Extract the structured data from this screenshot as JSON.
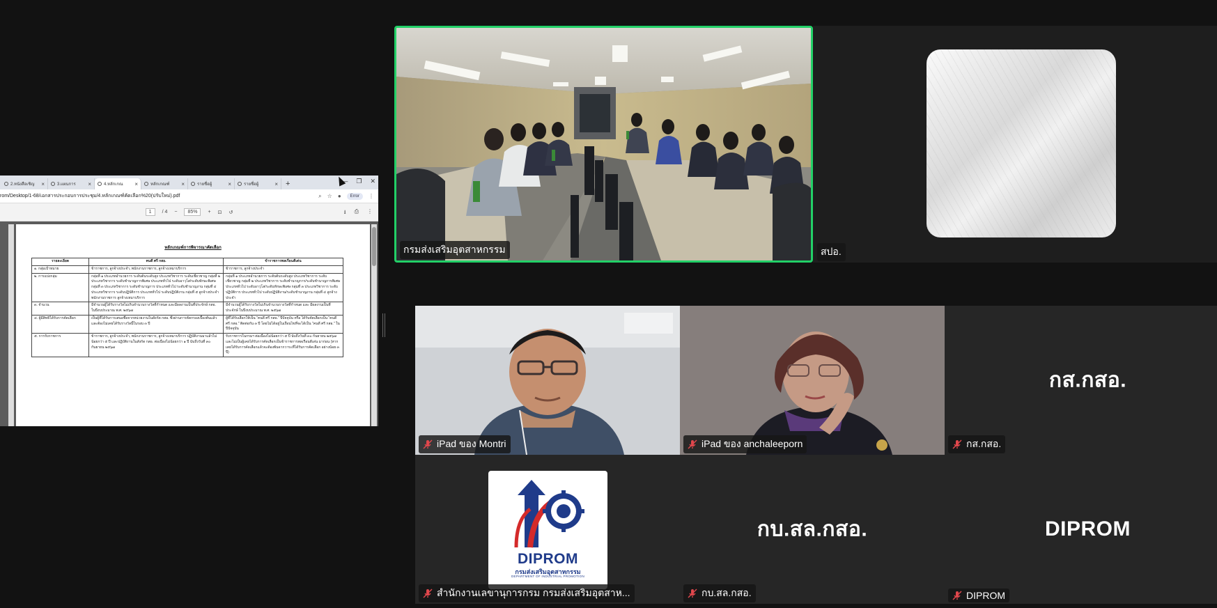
{
  "browser": {
    "tabs": [
      {
        "label": "2.หนังสือเชิญ"
      },
      {
        "label": "3.แผนการ"
      },
      {
        "label": "4.หลักเกณ"
      },
      {
        "label": "หลักเกณฑ์"
      },
      {
        "label": "รายชื่อผู้"
      },
      {
        "label": "รายชื่อผู้"
      }
    ],
    "new_tab": "+",
    "url": "rom/Desktop/1-68/เอกสารประกอบการประชุม/4.หลักเกณฑ์คัดเลือก%20(ปรับใหม่).pdf",
    "profile_label": "Error",
    "pdf": {
      "page_current": "1",
      "page_total": "/ 4",
      "zoom": "85%",
      "doc_title": "หลักเกณฑ์การพิจารณาคัดเลือก",
      "table": {
        "headers": [
          "รายละเอียด",
          "คนดี ศรี กสอ.",
          "ข้าราชการพลเรือนดีเด่น"
        ],
        "rows": [
          [
            "๑. กลุ่มเป้าหมาย",
            "ข้าราชการ, ลูกจ้างประจำ, พนักงานราชการ, ลูกจ้างเหมาบริการ",
            "ข้าราชการ, ลูกจ้างประจำ"
          ],
          [
            "๒. การแบ่งกลุ่ม",
            "กลุ่มที่ ๑ ประเภทอำนวยการ ระดับต้นระดับสูง ประเภทวิชาการ ระดับเชี่ยวชาญ กลุ่มที่ ๒ ประเภทวิชาการ ระดับชำนาญการพิเศษ ประเภททั่วไป ระดับอาวุโส/ระดับทักษะพิเศษ กลุ่มที่ ๓ ประเภทวิชาการ ระดับชำนาญการ ประเภททั่วไป ระดับชำนาญงาน กลุ่มที่ ๔ ประเภทวิชาการ ระดับปฏิบัติการ ประเภททั่วไป ระดับปฏิบัติงาน กลุ่มที่ ๕ ลูกจ้างประจำ พนักงานราชการ ลูกจ้างเหมาบริการ",
            "กลุ่มที่ ๑ ประเภทอำนวยการ ระดับต้นระดับสูง ประเภทวิชาการ ระดับเชี่ยวชาญ กลุ่มที่ ๒ ประเภทวิชาการ ระดับชำนาญการ/ระดับชำนาญการพิเศษ ประเภททั่วไป ระดับอาวุโส/ระดับทักษะพิเศษ กลุ่มที่ ๓ ประเภทวิชาการ ระดับปฏิบัติการ ประเภททั่วไป ระดับปฏิบัติงาน/ระดับชำนาญงาน กลุ่มที่ ๔ ลูกจ้างประจำ"
          ],
          [
            "๓. จำนวน",
            "มีจำนวนผู้ได้รับรางวัลไม่เกินจำนวนรางวัลที่กำหนด และมีผลงานเป็นที่ประจักษ์ กสอ. ในปีงบประมาณ พ.ศ. ๒๕๖๗",
            "มีจำนวนผู้ได้รับรางวัลไม่เกินจำนวนรางวัลที่กำหนด และ มีผลงานเป็นที่ประจักษ์ ในปีงบประมาณ พ.ศ. ๒๕๖๗"
          ],
          [
            "๔. ผู้มีสิทธิได้รับการคัดเลือก",
            "เป็นผู้ที่ได้รับการเสนอชื่อจากหน่วยงานในสังกัด กสอ. ซึ่งผ่านการคัดกรองเบื้องต้นแล้ว และต้องไม่เคยได้รับรางวัลนี้ในรอบ ๓ ปี",
            "ผู้ที่ได้รับเลือกให้เป็น \"คนดี ศรี กสอ.\" ปีปัจจุบัน หรือ ได้รับคัดเลือกเป็น \"คนดี ศรี กสอ.\" ติดต่อกัน ๓ ปี โดยไม่ได้อยู่ในเงื่อนไขที่จะได้เป็น \"คนดี ศรี กสอ.\" ในปีปัจจุบัน"
          ],
          [
            "๕. การรับราชการ",
            "ข้าราชการ, ลูกจ้างประจำ, พนักงานราชการ, ลูกจ้างเหมาบริการ ปฏิบัติงานมาแล้วไม่น้อยกว่า ๕ ปี และปฏิบัติงานในสังกัด กสอ. ต่อเนื่องไม่น้อยกว่า ๑ ปี นับถึงวันที่ ๓๐ กันยายน ๒๕๖๗",
            "รับราชการในกรมฯ ต่อเนื่องไม่น้อยกว่า ๕ ปี นับถึงวันที่ ๓๐ กันยายน ๒๕๖๗ และไม่เป็นผู้เคยได้รับการคัดเลือกเป็นข้าราชการพลเรือนดีเด่น มาก่อน (หากเคยได้รับการคัดเลือกแล้วจะต้องพ้นจากวาระที่ได้รับการคัดเลือก อย่างน้อย ๓ ปี)"
          ]
        ]
      }
    }
  },
  "tiles": {
    "room": {
      "name": "กรมส่งเสริมอุตสาหกรรม"
    },
    "spo": {
      "name": "สปอ."
    },
    "montri": {
      "name": "iPad ของ Montri"
    },
    "anchaleeporn": {
      "name": "iPad ของ anchaleeporn"
    },
    "ksk": {
      "name": "กส.กสอ.",
      "big": "กส.กสอ."
    },
    "office": {
      "name": "สำนักงานเลขานุการกรม กรมส่งเสริมอุตสาห...",
      "logo_word": "DIPROM",
      "logo_sub": "กรมส่งเสริมอุตสาหกรรม",
      "logo_sub2": "DEPARTMENT OF INDUSTRIAL PROMOTION"
    },
    "kbs": {
      "name": "กบ.สล.กสอ.",
      "big": "กบ.สล.กสอ."
    },
    "diprom": {
      "name": "DIPROM",
      "big": "DIPROM"
    }
  },
  "colors": {
    "active_speaker": "#22d067",
    "mute": "#e0474c",
    "background": "#121212"
  }
}
